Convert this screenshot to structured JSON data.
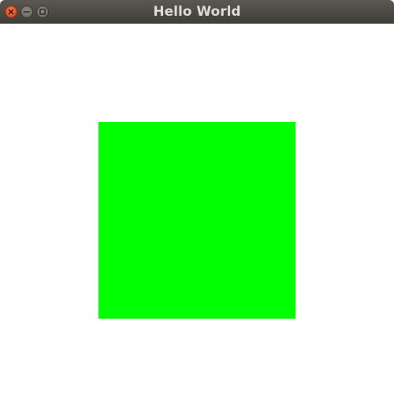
{
  "window": {
    "title": "Hello World",
    "controls": [
      {
        "icon": "close-icon"
      },
      {
        "icon": "minimize-icon"
      },
      {
        "icon": "maximize-icon"
      }
    ]
  },
  "canvas": {
    "background": "#ffffff",
    "square_color": "#00ff00"
  }
}
